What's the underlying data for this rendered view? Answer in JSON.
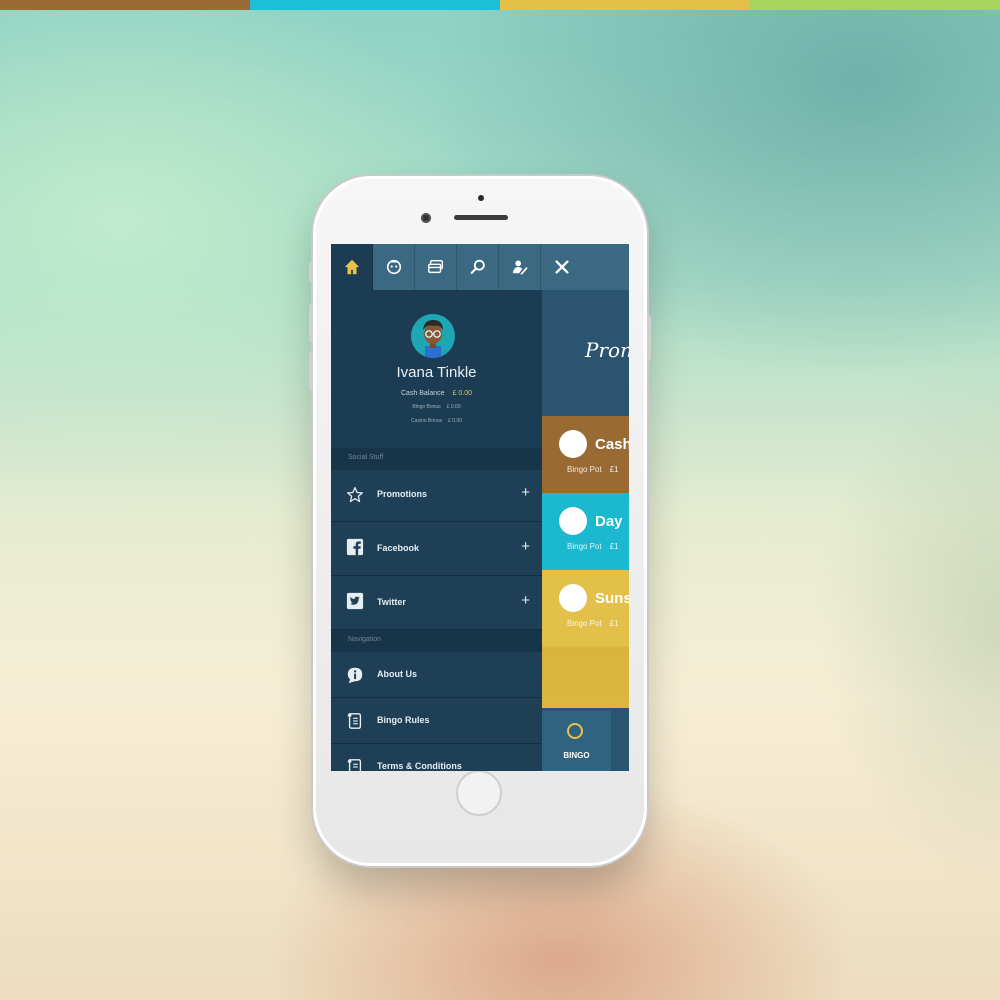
{
  "top_stripes": {
    "colors": [
      "#9a6a34",
      "#1bbfd6",
      "#e2c04a",
      "#a7d65c"
    ]
  },
  "toolbar": {
    "icons": [
      "home-icon",
      "avatar-face-icon",
      "cards-icon",
      "search-icon",
      "user-edit-icon",
      "close-icon"
    ],
    "active_color": "#e8c24a"
  },
  "profile": {
    "name": "Ivana Tinkle",
    "cash_balance_label": "Cash Balance",
    "cash_balance_value": "£ 0.00",
    "bingo_bonus_label": "Bingo Bonus",
    "bingo_bonus_value": "£ 0.00",
    "casino_bonus_label": "Casino Bonus",
    "casino_bonus_value": "£ 0.00"
  },
  "menu": {
    "social_header": "Social Stuff",
    "social_items": [
      {
        "label": "Promotions",
        "icon": "star-icon"
      },
      {
        "label": "Facebook",
        "icon": "facebook-icon"
      },
      {
        "label": "Twitter",
        "icon": "twitter-icon"
      }
    ],
    "nav_header": "Navigation",
    "nav_items": [
      {
        "label": "About Us",
        "icon": "info-icon"
      },
      {
        "label": "Bingo Rules",
        "icon": "scroll-icon"
      },
      {
        "label": "Terms & Conditions",
        "icon": "scroll-icon"
      }
    ]
  },
  "content": {
    "promo_title": "Prom",
    "cards": [
      {
        "title": "Cash",
        "sub_label": "Bingo Pot",
        "sub_value": "£1",
        "color": "#9a6a34"
      },
      {
        "title": "Day",
        "sub_label": "Bingo Pot",
        "sub_value": "£1",
        "color": "#1bb8d0"
      },
      {
        "title": "Suns",
        "sub_label": "Bingo Pot",
        "sub_value": "£1",
        "color": "#e2c04a"
      }
    ],
    "bottom_tab": "BINGO"
  }
}
